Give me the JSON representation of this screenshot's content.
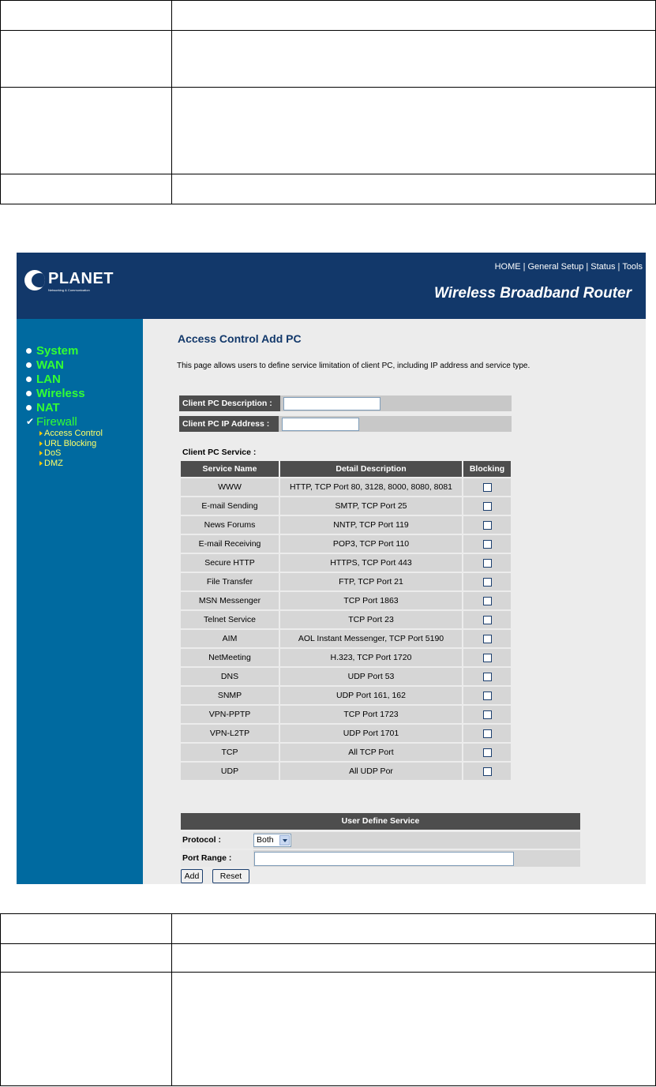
{
  "header": {
    "logo_text": "PLANET",
    "logo_subtext": "Networking & Communication",
    "top_links": [
      "HOME",
      "General Setup",
      "Status",
      "Tools"
    ],
    "product_title": "Wireless Broadband Router"
  },
  "sidebar": {
    "items": [
      {
        "label": "System"
      },
      {
        "label": "WAN"
      },
      {
        "label": "LAN"
      },
      {
        "label": "Wireless"
      },
      {
        "label": "NAT"
      },
      {
        "label": "Firewall"
      }
    ],
    "firewall_subitems": [
      {
        "label": "Access Control"
      },
      {
        "label": "URL Blocking"
      },
      {
        "label": "DoS"
      },
      {
        "label": "DMZ"
      }
    ]
  },
  "main": {
    "title": "Access Control Add PC",
    "description": "This page allows users to define service limitation of client PC, including IP address and service type.",
    "client_desc_label": "Client PC Description :",
    "client_desc_value": "",
    "client_ip_label": "Client PC IP Address :",
    "client_ip_value": "",
    "service_caption": "Client PC Service :",
    "service_headers": [
      "Service Name",
      "Detail Description",
      "Blocking"
    ],
    "services": [
      {
        "name": "WWW",
        "detail": "HTTP, TCP Port 80, 3128, 8000, 8080, 8081",
        "blocked": false
      },
      {
        "name": "E-mail Sending",
        "detail": "SMTP, TCP Port 25",
        "blocked": false
      },
      {
        "name": "News Forums",
        "detail": "NNTP, TCP Port 119",
        "blocked": false
      },
      {
        "name": "E-mail Receiving",
        "detail": "POP3, TCP Port 110",
        "blocked": false
      },
      {
        "name": "Secure HTTP",
        "detail": "HTTPS, TCP Port 443",
        "blocked": false
      },
      {
        "name": "File Transfer",
        "detail": "FTP, TCP Port 21",
        "blocked": false
      },
      {
        "name": "MSN Messenger",
        "detail": "TCP Port 1863",
        "blocked": false
      },
      {
        "name": "Telnet Service",
        "detail": "TCP Port 23",
        "blocked": false
      },
      {
        "name": "AIM",
        "detail": "AOL Instant Messenger, TCP Port 5190",
        "blocked": false
      },
      {
        "name": "NetMeeting",
        "detail": "H.323, TCP Port 1720",
        "blocked": false
      },
      {
        "name": "DNS",
        "detail": "UDP Port 53",
        "blocked": false
      },
      {
        "name": "SNMP",
        "detail": "UDP Port 161, 162",
        "blocked": false
      },
      {
        "name": "VPN-PPTP",
        "detail": "TCP Port 1723",
        "blocked": false
      },
      {
        "name": "VPN-L2TP",
        "detail": "UDP Port 1701",
        "blocked": false
      },
      {
        "name": "TCP",
        "detail": "All TCP Port",
        "blocked": false
      },
      {
        "name": "UDP",
        "detail": "All UDP Por",
        "blocked": false
      }
    ],
    "user_define_header": "User Define Service",
    "protocol_label": "Protocol :",
    "protocol_value": "Both",
    "port_range_label": "Port Range :",
    "port_range_value": "",
    "add_label": "Add",
    "reset_label": "Reset"
  },
  "colors": {
    "header_bg": "#12386a",
    "sidebar_bg": "#006aa0",
    "nav_text": "#33ff33",
    "subnav_text": "#ffff66",
    "table_header_bg": "#4d4d4d",
    "table_cell_bg": "#d6d6d6"
  }
}
